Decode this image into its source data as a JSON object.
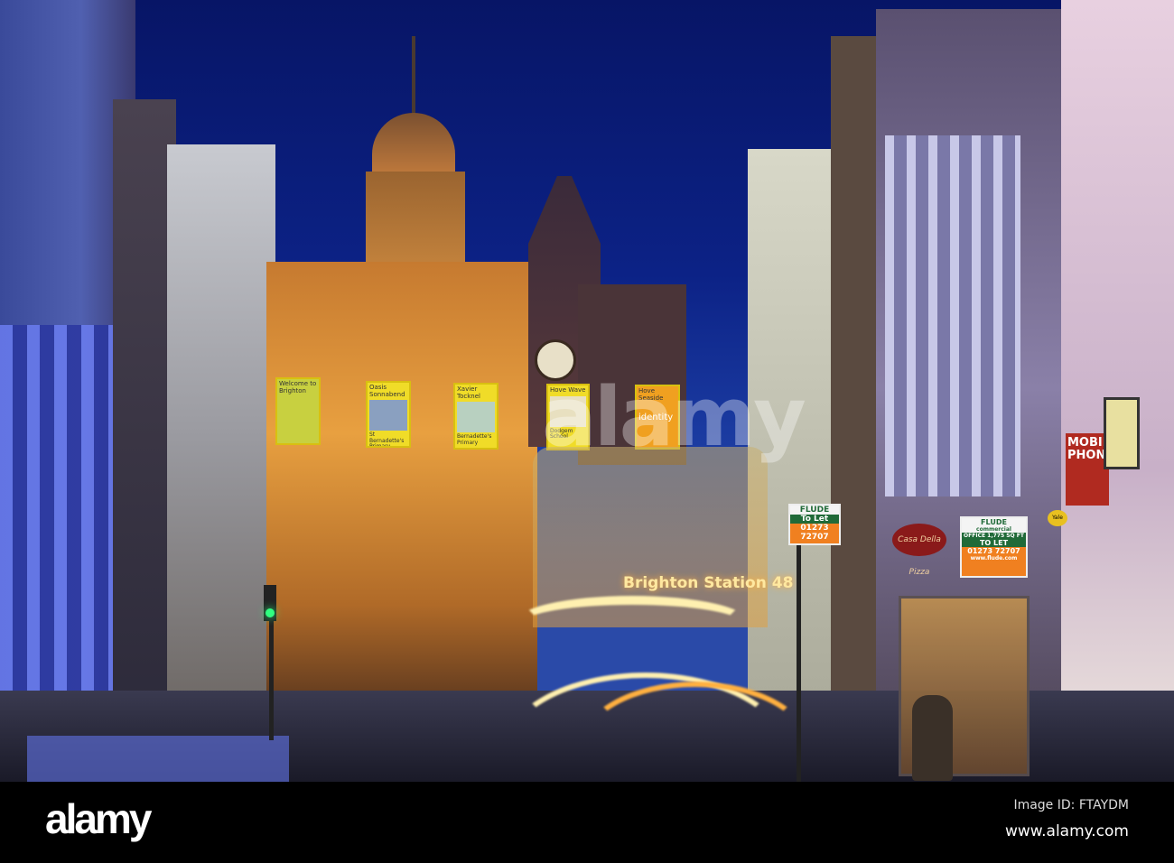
{
  "photo": {
    "banners": [
      {
        "title": "Welcome to Brighton"
      },
      {
        "title": "Oasis Sonnabend",
        "footer": "St Bernadette's Primary"
      },
      {
        "title": "Xavier Tocknel",
        "footer": "Bernadette's Primary"
      },
      {
        "title": "Hove Wave",
        "footer": "Dodgem School"
      },
      {
        "title": "Hove Seaside",
        "footer": "identity"
      }
    ],
    "bus_destination": "Brighton Station",
    "bus_number": "48",
    "signs": {
      "flude_small": {
        "brand": "FLUDE",
        "line": "To Let",
        "phone": "01273 72707"
      },
      "flude_large": {
        "brand": "FLUDE",
        "sub": "commercial",
        "area": "OFFICE 1,775 SQ FT",
        "line": "TO LET",
        "phone": "01273 72707",
        "url": "www.flude.com"
      },
      "mobile_phone": "MOBILE PHONE",
      "pizza": "Casa Della Pizza",
      "yale": "Yale"
    },
    "watermark": "alamy"
  },
  "footer": {
    "logo": "alamy",
    "image_id": "Image ID: FTAYDM",
    "url": "www.alamy.com"
  }
}
